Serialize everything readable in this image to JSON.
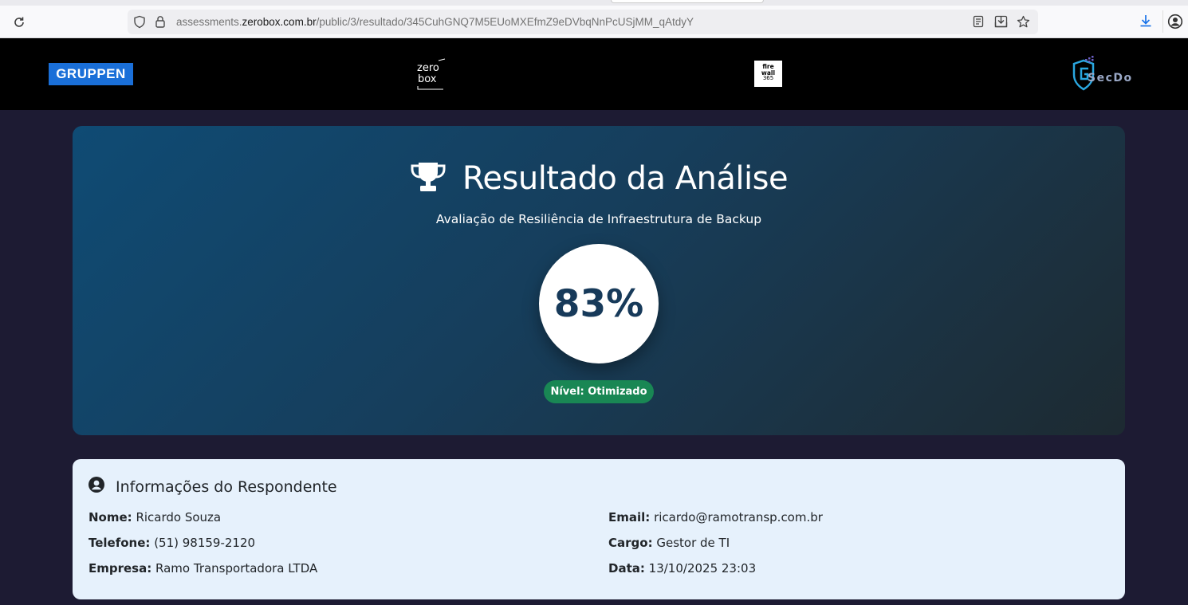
{
  "browser": {
    "url_prefix": "assessments.",
    "url_domain": "zerobox.com.br",
    "url_path": "/public/3/resultado/345CuhGNQ7M5EUoMXEfmZ9eDVbqNnPcUSjMM_qAtdyY"
  },
  "header": {
    "logos": {
      "gruppen": "GRUPPEN",
      "zerobox_line1": "zero",
      "zerobox_line2": "box",
      "firewall_line1": "fire",
      "firewall_line2": "wall",
      "firewall_line3": "365",
      "secdo": "SecDo"
    }
  },
  "result": {
    "title": "Resultado da Análise",
    "subtitle": "Avaliação de Resiliência de Infraestrutura de Backup",
    "score": "83%",
    "score_value": 83,
    "level_badge": "Nível: Otimizado",
    "badge_color": "#198754"
  },
  "respondent": {
    "heading": "Informações do Respondente",
    "fields": {
      "name_label": "Nome:",
      "name_value": "Ricardo Souza",
      "phone_label": "Telefone:",
      "phone_value": "(51) 98159-2120",
      "company_label": "Empresa:",
      "company_value": "Ramo Transportadora LTDA",
      "email_label": "Email:",
      "email_value": "ricardo@ramotransp.com.br",
      "role_label": "Cargo:",
      "role_value": "Gestor de TI",
      "date_label": "Data:",
      "date_value": "13/10/2025 23:03"
    }
  },
  "icons": {
    "reload": "reload-icon",
    "shield": "shield-icon",
    "lock": "lock-icon",
    "reader": "reader-view-icon",
    "save": "save-page-icon",
    "star": "bookmark-star-icon",
    "download": "download-icon",
    "account": "account-icon",
    "trophy": "trophy-icon",
    "user_circle": "user-circle-icon"
  }
}
